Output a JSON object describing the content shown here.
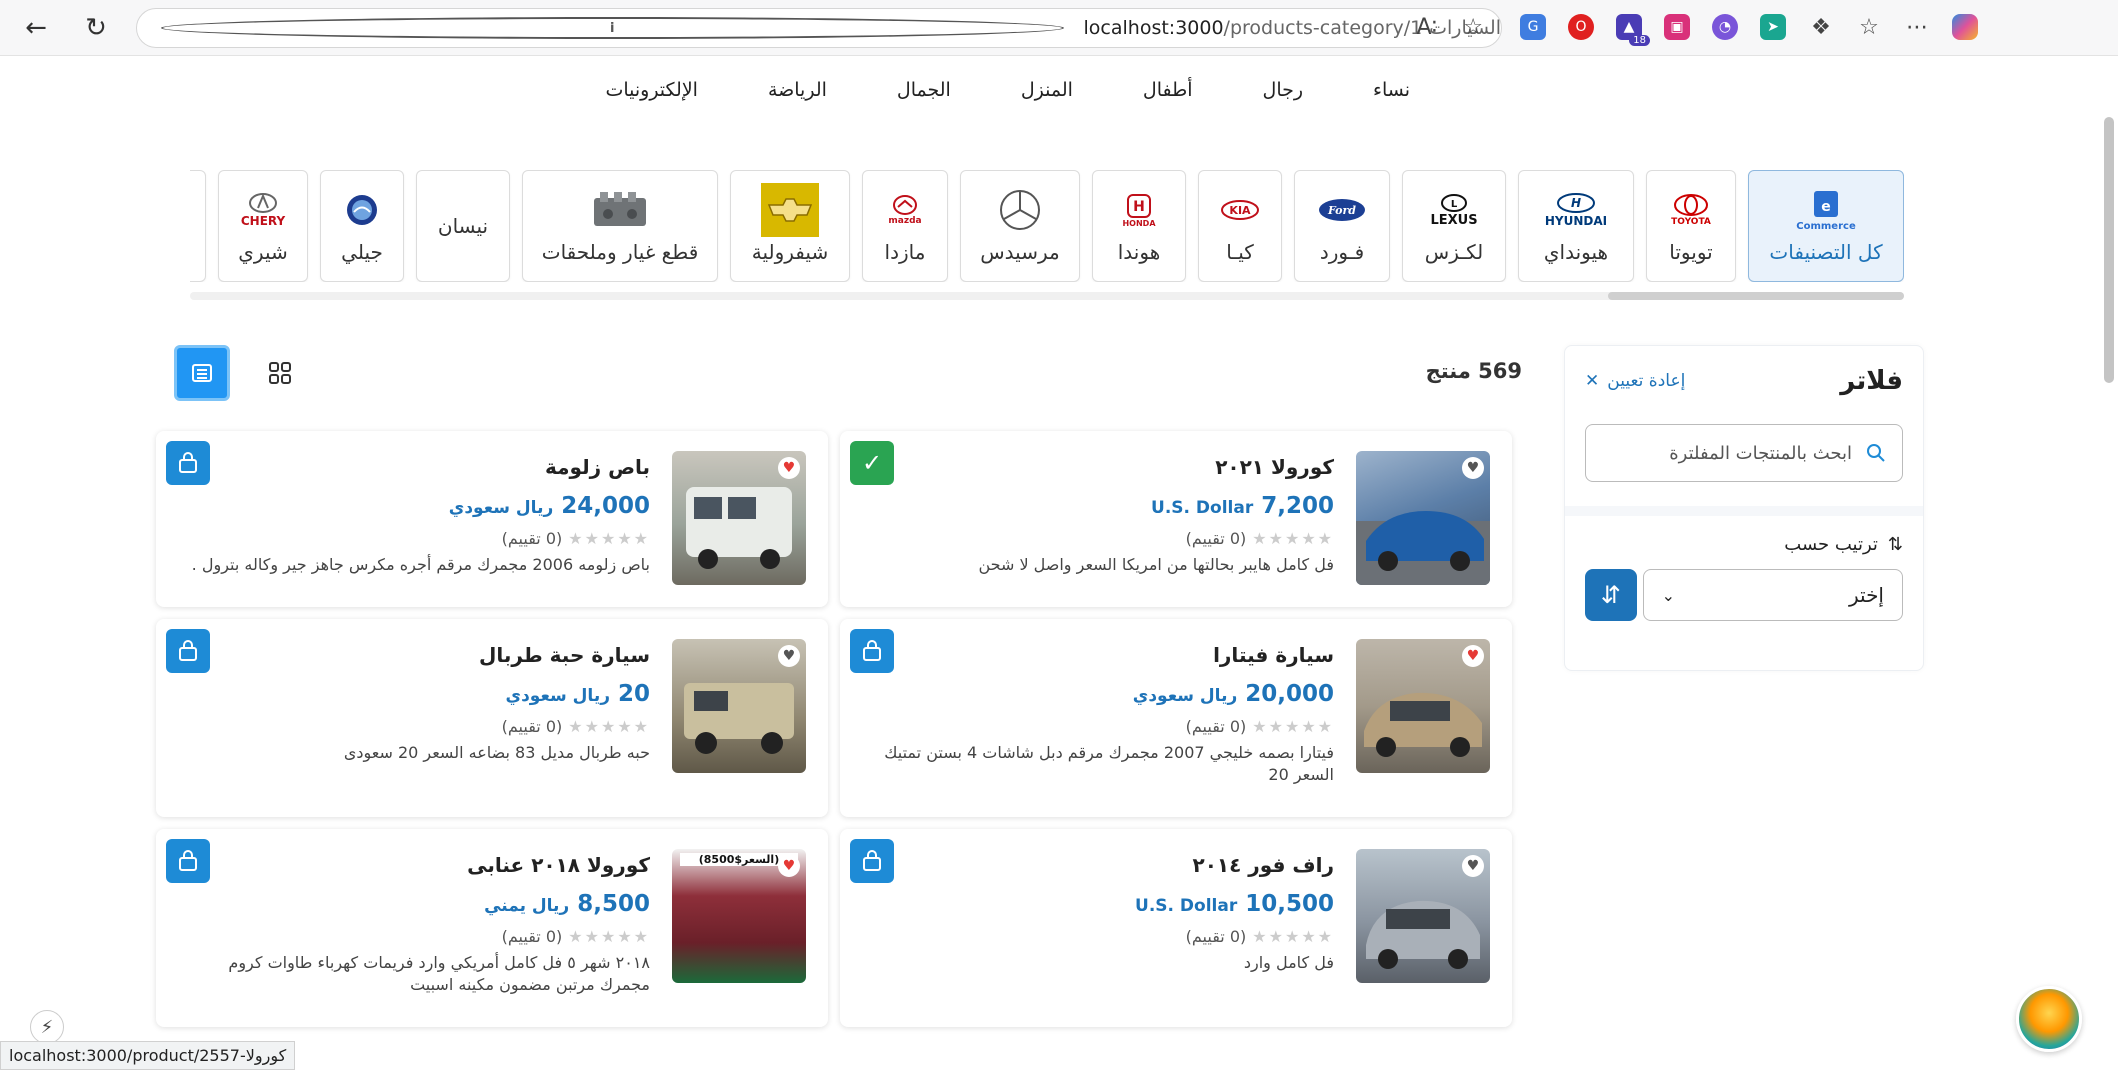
{
  "browser": {
    "url_host": "localhost:3000",
    "url_path": "/products-category/1-السيارات",
    "status_url": "localhost:3000/product/2557-كورولا"
  },
  "nav": [
    "نساء",
    "رجال",
    "أطفال",
    "المنزل",
    "الجمال",
    "الرياضة",
    "الإلكترونيات"
  ],
  "categories": [
    {
      "name": "كل التصنيفات",
      "logo": "e-commerce-icon"
    },
    {
      "name": "تويوتا",
      "logo": "toyota-logo"
    },
    {
      "name": "هيونداي",
      "logo": "hyundai-logo"
    },
    {
      "name": "لكـزس",
      "logo": "lexus-logo"
    },
    {
      "name": "فـورد",
      "logo": "ford-logo"
    },
    {
      "name": "كيـا",
      "logo": "kia-logo"
    },
    {
      "name": "هوندا",
      "logo": "honda-logo"
    },
    {
      "name": "مرسيدس",
      "logo": "mercedes-logo"
    },
    {
      "name": "مازدا",
      "logo": "mazda-logo"
    },
    {
      "name": "شيفرولية",
      "logo": "chevrolet-logo"
    },
    {
      "name": "قطع غيار وملحقات",
      "logo": "engine-icon"
    },
    {
      "name": "نيسان",
      "logo": ""
    },
    {
      "name": "جيلي",
      "logo": "geely-logo"
    },
    {
      "name": "شيري",
      "logo": "chery-logo"
    }
  ],
  "logo_text": {
    "toyota": "TOYOTA",
    "hyundai": "HYUNDAI",
    "lexus": "LEXUS",
    "ford": "Ford",
    "kia": "KIA",
    "honda": "HONDA",
    "mazda": "mazda",
    "chery": "CHERY",
    "ecommerce": "Commerce"
  },
  "filters": {
    "title": "فلاتر",
    "reset": "إعادة تعيين",
    "search_placeholder": "ابحث بالمنتجات المفلترة",
    "sort_label": "ترتيب حسب",
    "sort_value": "إختر"
  },
  "results": {
    "count": "569 منتج"
  },
  "products": [
    {
      "title": "كورولا ٢٠٢١",
      "price": "7,200",
      "currency": "U.S. Dollar",
      "rating": "(0 تقييم)",
      "desc": "فل كامل هايبر بحالتها من امريكا السعر واصل لا شحن",
      "liked": false,
      "thumb_color": "#5c7fa8"
    },
    {
      "title": "باص زلومة",
      "price": "24,000",
      "currency": "ريال سعودي",
      "rating": "(0 تقييم)",
      "desc": "باص زلومه 2006 مجمرك مرقم أجره مكرس جاهز جير وكاله بترول .",
      "liked": true,
      "thumb_color": "#9aa39a"
    },
    {
      "title": "سيارة فيتارا",
      "price": "20,000",
      "currency": "ريال سعودي",
      "rating": "(0 تقييم)",
      "desc": "فيتارا بصمه خليجي 2007 مجمرك مرقم دبل شاشات 4 بستن تمتيك السعر 20",
      "liked": true,
      "thumb_color": "#a39a8a"
    },
    {
      "title": "سيارة حبة طربال",
      "price": "20",
      "currency": "ريال سعودي",
      "rating": "(0 تقييم)",
      "desc": "حبه طربال مديل 83 بضاعه السعر 20 سعودى",
      "liked": false,
      "thumb_color": "#8f8670"
    },
    {
      "title": "راف فور ٢٠١٤",
      "price": "10,500",
      "currency": "U.S. Dollar",
      "rating": "(0 تقييم)",
      "desc": "فل كامل وارد",
      "liked": false,
      "thumb_color": "#8a94a0"
    },
    {
      "title": "كورولا ٢٠١٨ عنابى",
      "price": "8,500",
      "currency": "ريال يمني",
      "rating": "(0 تقييم)",
      "desc": "٢٠١٨ شهر ٥ فل كامل أمريكي وارد فريمات كهرباء طاوات كروم مجمرك مرتبن مضمون مكينه اسبيت",
      "liked": true,
      "thumb_color": "#8e2f3a",
      "thumb_text": "(السعر$8500)"
    }
  ]
}
